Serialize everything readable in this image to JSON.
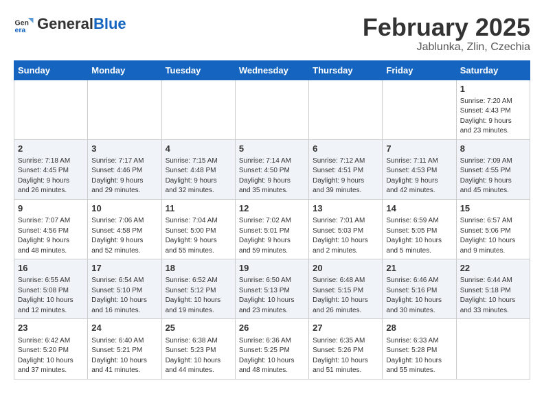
{
  "logo": {
    "text_general": "General",
    "text_blue": "Blue"
  },
  "title": {
    "month_year": "February 2025",
    "location": "Jablunka, Zlin, Czechia"
  },
  "weekdays": [
    "Sunday",
    "Monday",
    "Tuesday",
    "Wednesday",
    "Thursday",
    "Friday",
    "Saturday"
  ],
  "weeks": [
    [
      {
        "day": "",
        "info": ""
      },
      {
        "day": "",
        "info": ""
      },
      {
        "day": "",
        "info": ""
      },
      {
        "day": "",
        "info": ""
      },
      {
        "day": "",
        "info": ""
      },
      {
        "day": "",
        "info": ""
      },
      {
        "day": "1",
        "info": "Sunrise: 7:20 AM\nSunset: 4:43 PM\nDaylight: 9 hours\nand 23 minutes."
      }
    ],
    [
      {
        "day": "2",
        "info": "Sunrise: 7:18 AM\nSunset: 4:45 PM\nDaylight: 9 hours\nand 26 minutes."
      },
      {
        "day": "3",
        "info": "Sunrise: 7:17 AM\nSunset: 4:46 PM\nDaylight: 9 hours\nand 29 minutes."
      },
      {
        "day": "4",
        "info": "Sunrise: 7:15 AM\nSunset: 4:48 PM\nDaylight: 9 hours\nand 32 minutes."
      },
      {
        "day": "5",
        "info": "Sunrise: 7:14 AM\nSunset: 4:50 PM\nDaylight: 9 hours\nand 35 minutes."
      },
      {
        "day": "6",
        "info": "Sunrise: 7:12 AM\nSunset: 4:51 PM\nDaylight: 9 hours\nand 39 minutes."
      },
      {
        "day": "7",
        "info": "Sunrise: 7:11 AM\nSunset: 4:53 PM\nDaylight: 9 hours\nand 42 minutes."
      },
      {
        "day": "8",
        "info": "Sunrise: 7:09 AM\nSunset: 4:55 PM\nDaylight: 9 hours\nand 45 minutes."
      }
    ],
    [
      {
        "day": "9",
        "info": "Sunrise: 7:07 AM\nSunset: 4:56 PM\nDaylight: 9 hours\nand 48 minutes."
      },
      {
        "day": "10",
        "info": "Sunrise: 7:06 AM\nSunset: 4:58 PM\nDaylight: 9 hours\nand 52 minutes."
      },
      {
        "day": "11",
        "info": "Sunrise: 7:04 AM\nSunset: 5:00 PM\nDaylight: 9 hours\nand 55 minutes."
      },
      {
        "day": "12",
        "info": "Sunrise: 7:02 AM\nSunset: 5:01 PM\nDaylight: 9 hours\nand 59 minutes."
      },
      {
        "day": "13",
        "info": "Sunrise: 7:01 AM\nSunset: 5:03 PM\nDaylight: 10 hours\nand 2 minutes."
      },
      {
        "day": "14",
        "info": "Sunrise: 6:59 AM\nSunset: 5:05 PM\nDaylight: 10 hours\nand 5 minutes."
      },
      {
        "day": "15",
        "info": "Sunrise: 6:57 AM\nSunset: 5:06 PM\nDaylight: 10 hours\nand 9 minutes."
      }
    ],
    [
      {
        "day": "16",
        "info": "Sunrise: 6:55 AM\nSunset: 5:08 PM\nDaylight: 10 hours\nand 12 minutes."
      },
      {
        "day": "17",
        "info": "Sunrise: 6:54 AM\nSunset: 5:10 PM\nDaylight: 10 hours\nand 16 minutes."
      },
      {
        "day": "18",
        "info": "Sunrise: 6:52 AM\nSunset: 5:12 PM\nDaylight: 10 hours\nand 19 minutes."
      },
      {
        "day": "19",
        "info": "Sunrise: 6:50 AM\nSunset: 5:13 PM\nDaylight: 10 hours\nand 23 minutes."
      },
      {
        "day": "20",
        "info": "Sunrise: 6:48 AM\nSunset: 5:15 PM\nDaylight: 10 hours\nand 26 minutes."
      },
      {
        "day": "21",
        "info": "Sunrise: 6:46 AM\nSunset: 5:16 PM\nDaylight: 10 hours\nand 30 minutes."
      },
      {
        "day": "22",
        "info": "Sunrise: 6:44 AM\nSunset: 5:18 PM\nDaylight: 10 hours\nand 33 minutes."
      }
    ],
    [
      {
        "day": "23",
        "info": "Sunrise: 6:42 AM\nSunset: 5:20 PM\nDaylight: 10 hours\nand 37 minutes."
      },
      {
        "day": "24",
        "info": "Sunrise: 6:40 AM\nSunset: 5:21 PM\nDaylight: 10 hours\nand 41 minutes."
      },
      {
        "day": "25",
        "info": "Sunrise: 6:38 AM\nSunset: 5:23 PM\nDaylight: 10 hours\nand 44 minutes."
      },
      {
        "day": "26",
        "info": "Sunrise: 6:36 AM\nSunset: 5:25 PM\nDaylight: 10 hours\nand 48 minutes."
      },
      {
        "day": "27",
        "info": "Sunrise: 6:35 AM\nSunset: 5:26 PM\nDaylight: 10 hours\nand 51 minutes."
      },
      {
        "day": "28",
        "info": "Sunrise: 6:33 AM\nSunset: 5:28 PM\nDaylight: 10 hours\nand 55 minutes."
      },
      {
        "day": "",
        "info": ""
      }
    ]
  ]
}
